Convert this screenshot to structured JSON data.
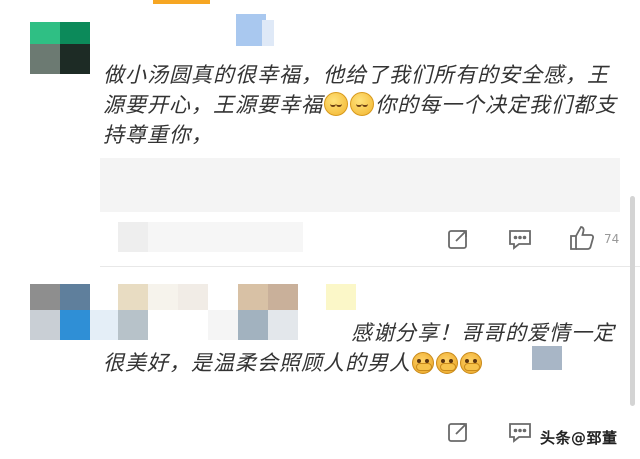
{
  "comments": [
    {
      "text_parts": [
        "做小汤圆真的很幸福，他给了我们所有的安全感，王源要开心，王源要幸福",
        "你的每一个决定我们都支持尊重你，"
      ],
      "emojis": [
        "relieved-face-icon",
        "relieved-face-icon"
      ],
      "actions": {
        "share": "share-icon",
        "comment": "comment-icon",
        "like": "like-icon"
      },
      "like_count": "74"
    },
    {
      "text_parts": [
        "感谢分享！哥哥的爱情一定很美好，是温柔会照顾人的男人"
      ],
      "emojis": [
        "hand-over-face-icon",
        "hand-over-face-icon",
        "hand-over-face-icon"
      ],
      "actions": {
        "share": "share-icon",
        "comment": "comment-icon",
        "like": "like-icon"
      },
      "like_count": ""
    }
  ],
  "watermark": "头条@郅董",
  "colors": {
    "text": "#333333",
    "icon": "#666666",
    "count": "#999999",
    "divider": "#e8e8e8"
  }
}
